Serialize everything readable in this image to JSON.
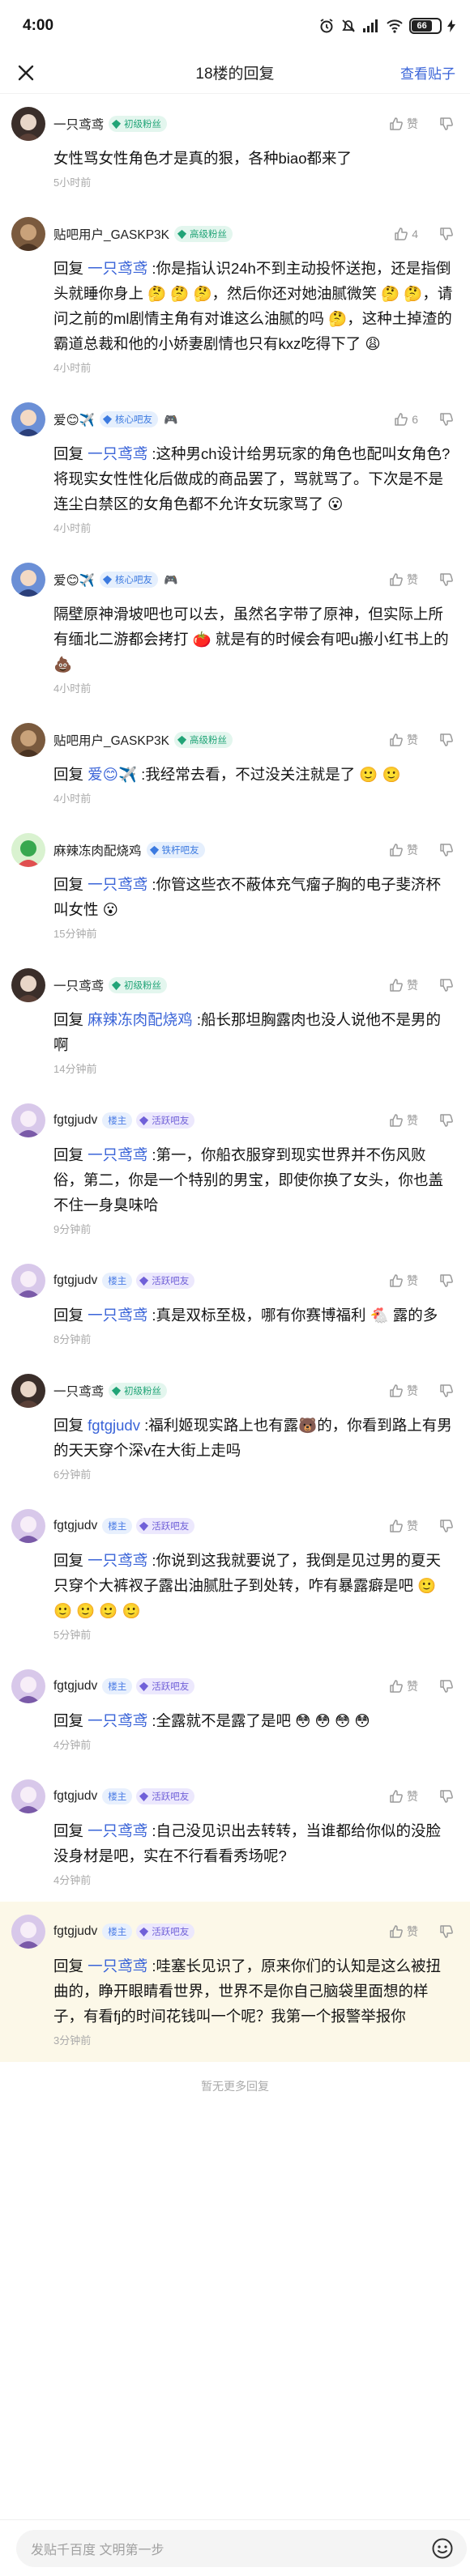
{
  "status": {
    "time": "4:00",
    "battery": "66"
  },
  "nav": {
    "title": "18楼的回复",
    "view_post": "查看贴子"
  },
  "reply_prefix": "回复",
  "colors": {
    "accent": "#3a64d8",
    "highlight": "#fcf8e8"
  },
  "comments": [
    {
      "user": "一只鸢鸢",
      "badge": "初级粉丝",
      "badge_type": "green",
      "likes": "赞",
      "text": "女性骂女性角色才是真的狠，各种biao都来了",
      "time": "5小时前"
    },
    {
      "user": "贴吧用户_GASKP3K",
      "badge": "高级粉丝",
      "badge_type": "green",
      "likes": "4",
      "reply_to": "一只鸢鸢",
      "text": ":你是指认识24h不到主动投怀送抱，还是指倒头就睡你身上 🤔 🤔 🤔，然后你还对她油腻微笑 🤔 🤔，请问之前的ml剧情主角有对谁这么油腻的吗 🤔，这种土掉渣的霸道总裁和他的小娇妻剧情也只有kxz吃得下了 😩",
      "time": "4小时前"
    },
    {
      "user": "爱😊✈️",
      "badge": "核心吧友",
      "badge_type": "blue",
      "badge_emoji": "🎮",
      "likes": "6",
      "reply_to": "一只鸢鸢",
      "text": ":这种男ch设计给男玩家的角色也配叫女角色? 将现实女性性化后做成的商品罢了，骂就骂了。下次是不是连尘白禁区的女角色都不允许女玩家骂了 😮",
      "time": "4小时前"
    },
    {
      "user": "爱😊✈️",
      "badge": "核心吧友",
      "badge_type": "blue",
      "badge_emoji": "🎮",
      "likes": "赞",
      "text": "隔壁原神滑坡吧也可以去，虽然名字带了原神，但实际上所有缅北二游都会拷打 🍅 就是有的时候会有吧u搬小红书上的 💩",
      "time": "4小时前"
    },
    {
      "user": "贴吧用户_GASKP3K",
      "badge": "高级粉丝",
      "badge_type": "green",
      "likes": "赞",
      "reply_to": "爱😊✈️",
      "text": ":我经常去看，不过没关注就是了 🙂 🙂",
      "time": "4小时前"
    },
    {
      "user": "麻辣冻肉配烧鸡",
      "badge": "铁杆吧友",
      "badge_type": "blue",
      "likes": "赞",
      "reply_to": "一只鸢鸢",
      "text": ":你管这些衣不蔽体充气瘤子胸的电子斐济杯叫女性 😮",
      "time": "15分钟前"
    },
    {
      "user": "一只鸢鸢",
      "badge": "初级粉丝",
      "badge_type": "green",
      "likes": "赞",
      "reply_to": "麻辣冻肉配烧鸡",
      "text": ":船长那坦胸露肉也没人说他不是男的啊",
      "time": "14分钟前"
    },
    {
      "user": "fgtgjudv",
      "owner": "楼主",
      "badge": "活跃吧友",
      "badge_type": "purple",
      "likes": "赞",
      "reply_to": "一只鸢鸢",
      "text": ":第一，你船衣服穿到现实世界并不伤风败俗，第二，你是一个特别的男宝，即使你换了女头，你也盖不住一身臭味哈",
      "time": "9分钟前"
    },
    {
      "user": "fgtgjudv",
      "owner": "楼主",
      "badge": "活跃吧友",
      "badge_type": "purple",
      "likes": "赞",
      "reply_to": "一只鸢鸢",
      "text": ":真是双标至极，哪有你赛博福利 🐔 露的多",
      "time": "8分钟前"
    },
    {
      "user": "一只鸢鸢",
      "badge": "初级粉丝",
      "badge_type": "green",
      "likes": "赞",
      "reply_to": "fgtgjudv",
      "text": ":福利姬现实路上也有露🐻的，你看到路上有男的天天穿个深v在大街上走吗",
      "time": "6分钟前"
    },
    {
      "user": "fgtgjudv",
      "owner": "楼主",
      "badge": "活跃吧友",
      "badge_type": "purple",
      "likes": "赞",
      "reply_to": "一只鸢鸢",
      "text": ":你说到这我就要说了，我倒是见过男的夏天只穿个大裤衩子露出油腻肚子到处转，咋有暴露癖是吧 🙂 🙂 🙂 🙂 🙂",
      "time": "5分钟前"
    },
    {
      "user": "fgtgjudv",
      "owner": "楼主",
      "badge": "活跃吧友",
      "badge_type": "purple",
      "likes": "赞",
      "reply_to": "一只鸢鸢",
      "text": ":全露就不是露了是吧 😳 😳 😳 😳",
      "time": "4分钟前"
    },
    {
      "user": "fgtgjudv",
      "owner": "楼主",
      "badge": "活跃吧友",
      "badge_type": "purple",
      "likes": "赞",
      "reply_to": "一只鸢鸢",
      "text": ":自己没见识出去转转，当谁都给你似的没脸没身材是吧，实在不行看看秀场呢?",
      "time": "4分钟前"
    },
    {
      "user": "fgtgjudv",
      "owner": "楼主",
      "badge": "活跃吧友",
      "badge_type": "purple",
      "likes": "赞",
      "reply_to": "一只鸢鸢",
      "text": ":哇塞长见识了，原来你们的认知是这么被扭曲的，睁开眼睛看世界，世界不是你自己脑袋里面想的样子，有看fj的时间花钱叫一个呢？我第一个报警举报你",
      "time": "3分钟前",
      "highlight": true
    }
  ],
  "footer_note": "暂无更多回复",
  "input_placeholder": "发贴千百度 文明第一步"
}
